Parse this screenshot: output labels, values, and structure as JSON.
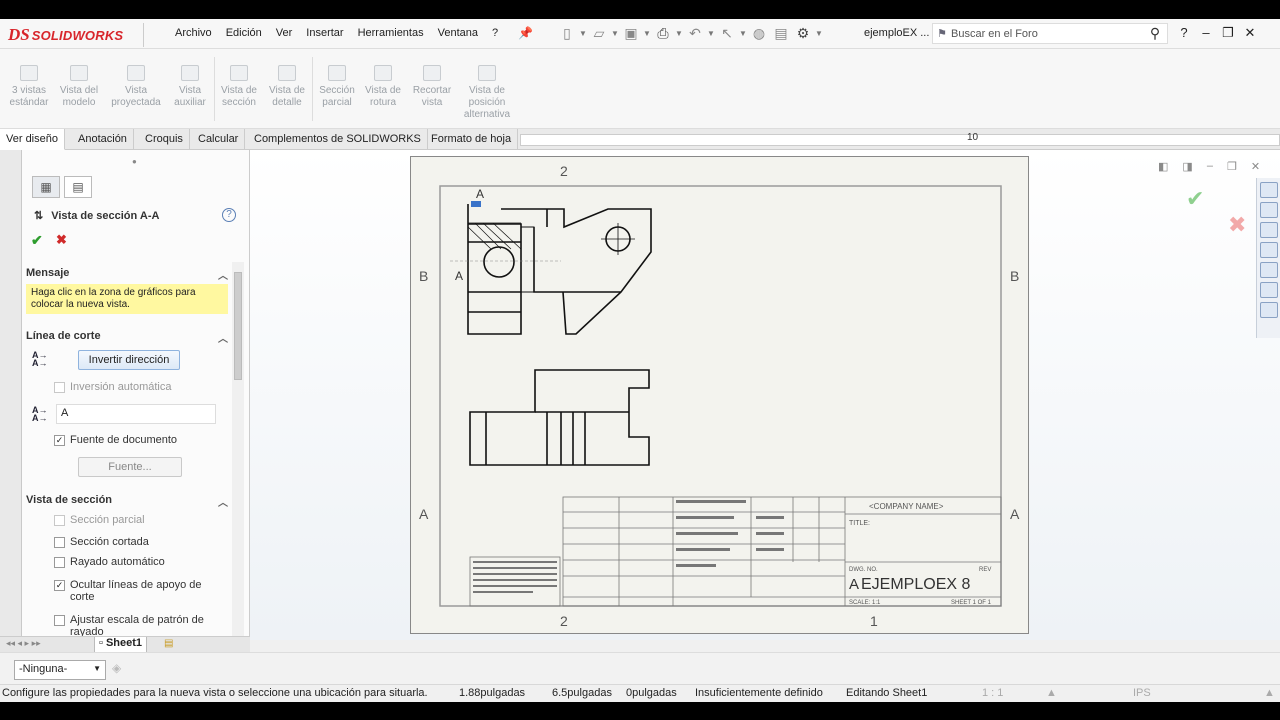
{
  "app": {
    "brand": "SOLIDWORKS",
    "menu": [
      "Archivo",
      "Edición",
      "Ver",
      "Insertar",
      "Herramientas",
      "Ventana",
      "?"
    ],
    "document_name": "ejemploEX ...",
    "search_placeholder": "Buscar en el Foro",
    "help": "?"
  },
  "ribbon": {
    "buttons": [
      {
        "label": "3 vistas estándar"
      },
      {
        "label": "Vista del modelo"
      },
      {
        "label": "Vista proyectada"
      },
      {
        "label": "Vista auxiliar"
      },
      {
        "label": "Vista de sección"
      },
      {
        "label": "Vista de detalle"
      },
      {
        "label": "Sección parcial"
      },
      {
        "label": "Vista de rotura"
      },
      {
        "label": "Recortar vista"
      },
      {
        "label": "Vista de posición alternativa"
      }
    ]
  },
  "tabs": [
    "Ver diseño",
    "Anotación",
    "Croquis",
    "Calcular",
    "Complementos de SOLIDWORKS",
    "Formato de hoja"
  ],
  "ruler_mark": "10",
  "panel": {
    "title": "Vista de sección A-A",
    "help": "?",
    "mensaje_header": "Mensaje",
    "mensaje_text": "Haga clic en la zona de gráficos para colocar la nueva vista.",
    "linea_header": "Línea de corte",
    "invertir_label": "Invertir dirección",
    "inversion_auto": "Inversión automática",
    "label_value": "A",
    "fuente_documento": "Fuente de documento",
    "fuente_button": "Fuente...",
    "vista_header": "Vista de sección",
    "options": [
      {
        "label": "Sección parcial",
        "checked": false,
        "disabled": true
      },
      {
        "label": "Sección cortada",
        "checked": false,
        "disabled": false
      },
      {
        "label": "Rayado automático",
        "checked": false,
        "disabled": false
      },
      {
        "label": "Ocultar líneas de apoyo de corte",
        "checked": true,
        "disabled": false
      },
      {
        "label": "Ajustar escala de patrón de rayado",
        "checked": false,
        "disabled": false
      }
    ]
  },
  "sheet": {
    "tab": "Sheet1",
    "zone_top": [
      "2"
    ],
    "zone_bottom": [
      "2",
      "1"
    ],
    "zone_left": [
      "B",
      "A"
    ],
    "zone_right": [
      "B",
      "A"
    ],
    "section_label": "A",
    "title_block": {
      "company": "<COMPANY NAME>",
      "title": "TITLE:",
      "size": "A",
      "dwg_no_label": "DWG. NO.",
      "dwg_no": "EJEMPLOEX 8",
      "rev": "REV",
      "scale": "SCALE: 1:1",
      "sheet": "SHEET 1 OF 1"
    }
  },
  "bottom": {
    "layer": "-Ninguna-"
  },
  "status": {
    "message": "Configure las propiedades para la nueva vista o seleccione una ubicación para situarla.",
    "x": "1.88pulgadas",
    "y": "6.5pulgadas",
    "z": "0pulgadas",
    "state": "Insuficientemente definido",
    "editing": "Editando Sheet1",
    "scale": "1 : 1",
    "units": "IPS"
  }
}
